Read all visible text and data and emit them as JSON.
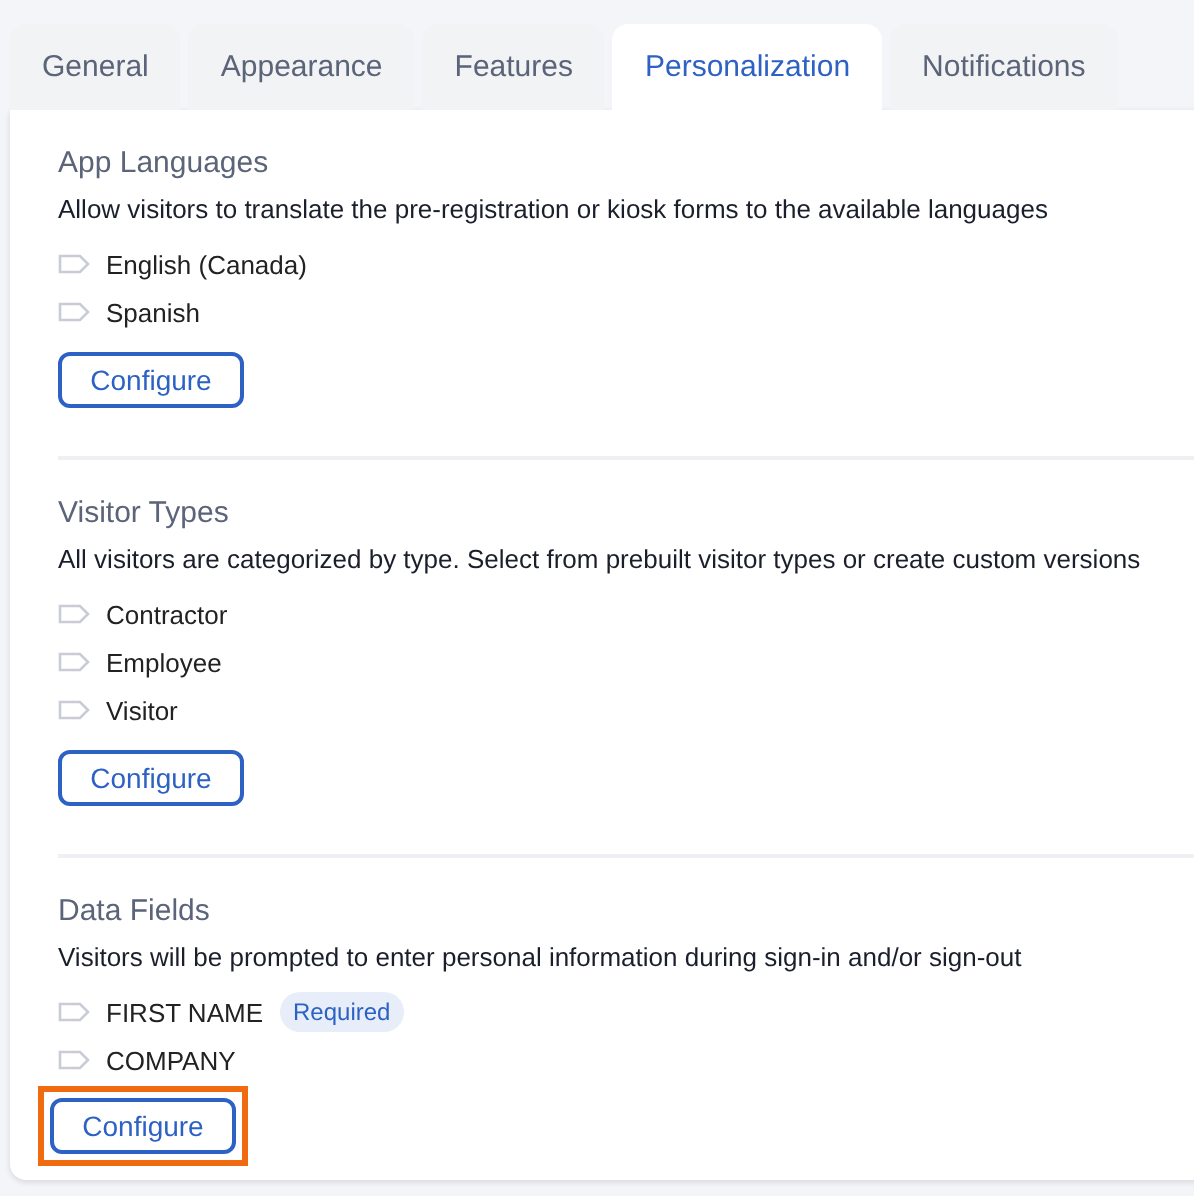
{
  "tabs": [
    {
      "label": "General",
      "selected": false
    },
    {
      "label": "Appearance",
      "selected": false
    },
    {
      "label": "Features",
      "selected": false
    },
    {
      "label": "Personalization",
      "selected": true
    },
    {
      "label": "Notifications",
      "selected": false
    }
  ],
  "sections": [
    {
      "title": "App Languages",
      "description": "Allow visitors to translate the pre-registration or kiosk forms to the available languages",
      "items": [
        {
          "label": "English (Canada)"
        },
        {
          "label": "Spanish"
        }
      ],
      "button": {
        "label": "Configure",
        "highlighted": false
      }
    },
    {
      "title": "Visitor Types",
      "description": "All visitors are categorized by type. Select from prebuilt visitor types or create custom versions",
      "items": [
        {
          "label": "Contractor"
        },
        {
          "label": "Employee"
        },
        {
          "label": "Visitor"
        }
      ],
      "button": {
        "label": "Configure",
        "highlighted": false
      }
    },
    {
      "title": "Data Fields",
      "description": "Visitors will be prompted to enter personal information during sign-in and/or sign-out",
      "items": [
        {
          "label": "FIRST NAME",
          "badge": "Required"
        },
        {
          "label": "COMPANY"
        }
      ],
      "button": {
        "label": "Configure",
        "highlighted": true
      }
    }
  ]
}
